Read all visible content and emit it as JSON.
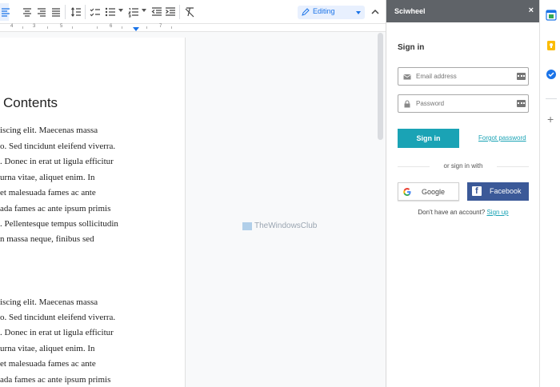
{
  "toolbar": {
    "editing_mode_label": "Editing",
    "icons": [
      "align-left-icon",
      "align-center-icon",
      "align-right-icon",
      "align-justify-icon",
      "line-spacing-icon",
      "checklist-icon",
      "bulleted-list-icon",
      "numbered-list-icon",
      "decrease-indent-icon",
      "increase-indent-icon",
      "clear-formatting-icon",
      "pencil-icon",
      "collapse-icon"
    ]
  },
  "ruler": {
    "numbers": [
      "4",
      "3",
      "5",
      "6",
      "7"
    ]
  },
  "document": {
    "heading": "Contents",
    "paragraph1": [
      "iscing elit. Maecenas massa",
      "o. Sed tincidunt eleifend viverra.",
      ". Donec in erat ut ligula efficitur",
      " urna vitae, aliquet enim. In",
      " et malesuada fames ac ante",
      "ada fames ac ante ipsum primis",
      ". Pellentesque tempus sollicitudin",
      "n massa neque, finibus sed"
    ],
    "paragraph2": [
      "iscing elit. Maecenas massa",
      "o. Sed tincidunt eleifend viverra.",
      ". Donec in erat ut ligula efficitur",
      " urna vitae, aliquet enim. In",
      " et malesuada fames ac ante",
      "ada fames ac ante ipsum primis"
    ],
    "watermark": "TheWindowsClub"
  },
  "panel": {
    "title": "Sciwheel",
    "close_label": "×",
    "signin_heading": "Sign in",
    "email_placeholder": "Email address",
    "password_placeholder": "Password",
    "signin_button": "Sign in",
    "forgot_link": "Forgot password",
    "divider": "or sign in with",
    "google_label": "Google",
    "facebook_label": "Facebook",
    "no_account_text": "Don't have an account?",
    "signup_link": "Sign up"
  },
  "sidebar": {
    "icons": [
      "calendar-icon",
      "keep-icon",
      "tasks-icon",
      "add-icon"
    ],
    "add_label": "+"
  },
  "colors": {
    "accent": "#1aa3b5",
    "facebook": "#3b5998",
    "header": "#5f6368",
    "editing_blue": "#1a73e8"
  }
}
